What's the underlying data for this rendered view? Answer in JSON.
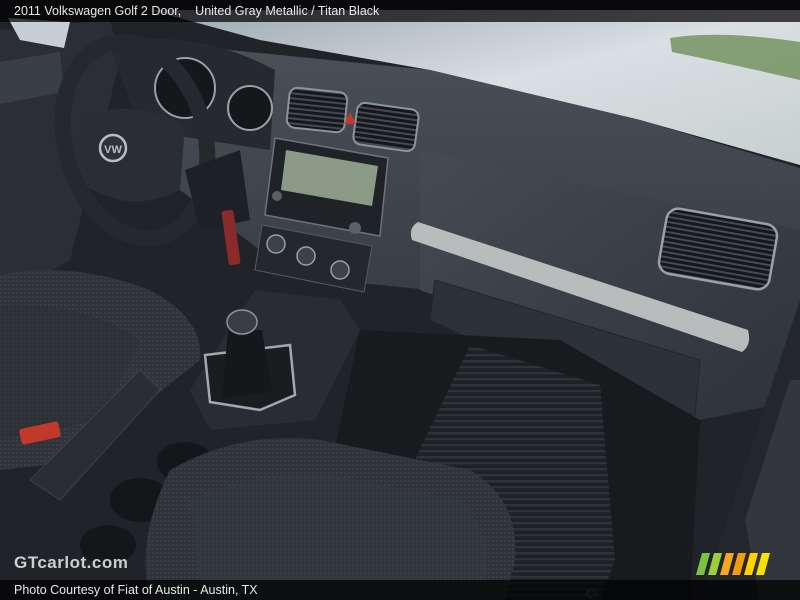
{
  "caption": {
    "car": "2011 Volkswagen Golf 2 Door,",
    "colors": "United Gray Metallic / Titan Black"
  },
  "credit": {
    "text": "Photo Courtesy of Fiat of Austin - Austin, TX"
  },
  "watermark": {
    "site": "GTcarlot.com"
  },
  "photo": {
    "subject": "Volkswagen Golf interior: dashboard, steering wheel, center console with manual gear shifter, cloth seats, floor mat"
  },
  "colors": {
    "dash": "#3b4048",
    "seat": "#2c3036",
    "trim": "#b9bcbd",
    "windshield": "#d7dee3"
  }
}
